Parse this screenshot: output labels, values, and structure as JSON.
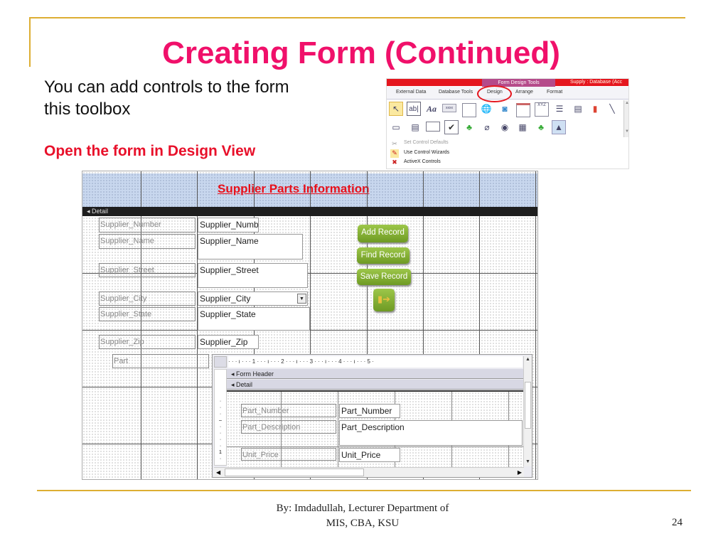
{
  "slide": {
    "title": "Creating Form (Continued)",
    "body_line1": "You can add controls to the form",
    "body_line2": "this toolbox",
    "instruction": "Open the form in Design View",
    "footer_line1": "By: Imdadullah, Lecturer Department of",
    "footer_line2": "MIS, CBA, KSU",
    "page_number": "24",
    "colors": {
      "title": "#F0106A",
      "instruction": "#E8102A",
      "rule": "#DDAE33"
    }
  },
  "ribbon": {
    "context_tab": "Form Design Tools",
    "window_title": "Supply : Database (Acc",
    "tabs": [
      "External Data",
      "Database Tools",
      "Design",
      "Arrange",
      "Format"
    ],
    "highlighted_tab": "Design",
    "tools_row1": [
      "select-pointer",
      "text-box",
      "label",
      "button",
      "tab-control",
      "hyperlink",
      "web-browser",
      "navigation",
      "option-group",
      "page-break",
      "combo-box",
      "chart",
      "line"
    ],
    "tools_row2": [
      "toggle-button",
      "list-box",
      "rectangle",
      "check-box",
      "unbound-object-frame",
      "attachment",
      "option-button",
      "subform",
      "bound-object-frame",
      "image"
    ],
    "menu": [
      "Set Control Defaults",
      "Use Control Wizards",
      "ActiveX Controls"
    ]
  },
  "designer": {
    "header_title": "Supplier  Parts Information",
    "detail_label": "Detail",
    "fields": [
      {
        "label": "Supplier_Number",
        "control": "Supplier_Numb"
      },
      {
        "label": "Supplier_Name",
        "control": "Supplier_Name"
      },
      {
        "label": "Supplier_Street",
        "control": "Supplier_Street"
      },
      {
        "label": "Supplier_City",
        "control": "Supplier_City"
      },
      {
        "label": "Supplier_State",
        "control": "Supplier_State"
      },
      {
        "label": "Supplier_Zip",
        "control": "Supplier_Zip"
      }
    ],
    "part_label": "Part",
    "buttons": [
      "Add Record",
      "Find Record",
      "Save Record"
    ],
    "subform": {
      "ruler": "·  ·  ·  ı  ·  ·  ·  1  ·  ·  ·  ı  ·  ·  ·  2  ·  ·  ·  ı  ·  ·  ·  3  ·  ·  ·  ı  ·  ·  ·  4  ·  ·  ·  ı  ·  ·  ·  5  ·",
      "form_header": "Form Header",
      "detail": "Detail",
      "fields": [
        {
          "label": "Part_Number",
          "control": "Part_Number"
        },
        {
          "label": "Part_Description",
          "control": "Part_Description"
        },
        {
          "label": "Unit_Price",
          "control": "Unit_Price"
        }
      ]
    }
  }
}
